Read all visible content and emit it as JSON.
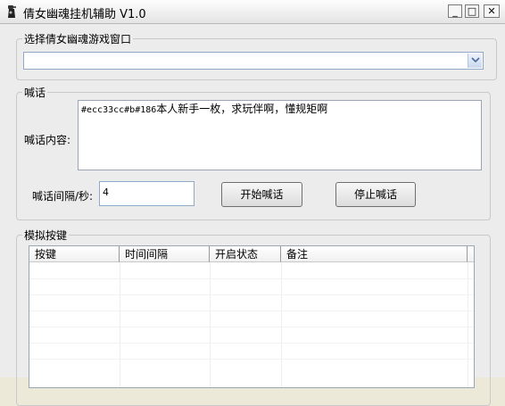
{
  "window": {
    "title": "倩女幽魂挂机辅助 V1.0",
    "minimize": "_",
    "maximize": "□",
    "close": "✕"
  },
  "select_window": {
    "legend": "选择倩女幽魂游戏窗口",
    "value": ""
  },
  "shout": {
    "legend": "喊话",
    "content_label": "喊话内容:",
    "content_code": "#ecc33cc#b#186",
    "content_text": "本人新手一枚，求玩伴啊，懂规矩啊",
    "interval_label": "喊话间隔/秒:",
    "interval_value": "4",
    "start_label": "开始喊话",
    "stop_label": "停止喊话"
  },
  "keys": {
    "legend": "模拟按键",
    "columns": [
      "按键",
      "时间间隔",
      "开启状态",
      "备注"
    ],
    "rows": []
  }
}
